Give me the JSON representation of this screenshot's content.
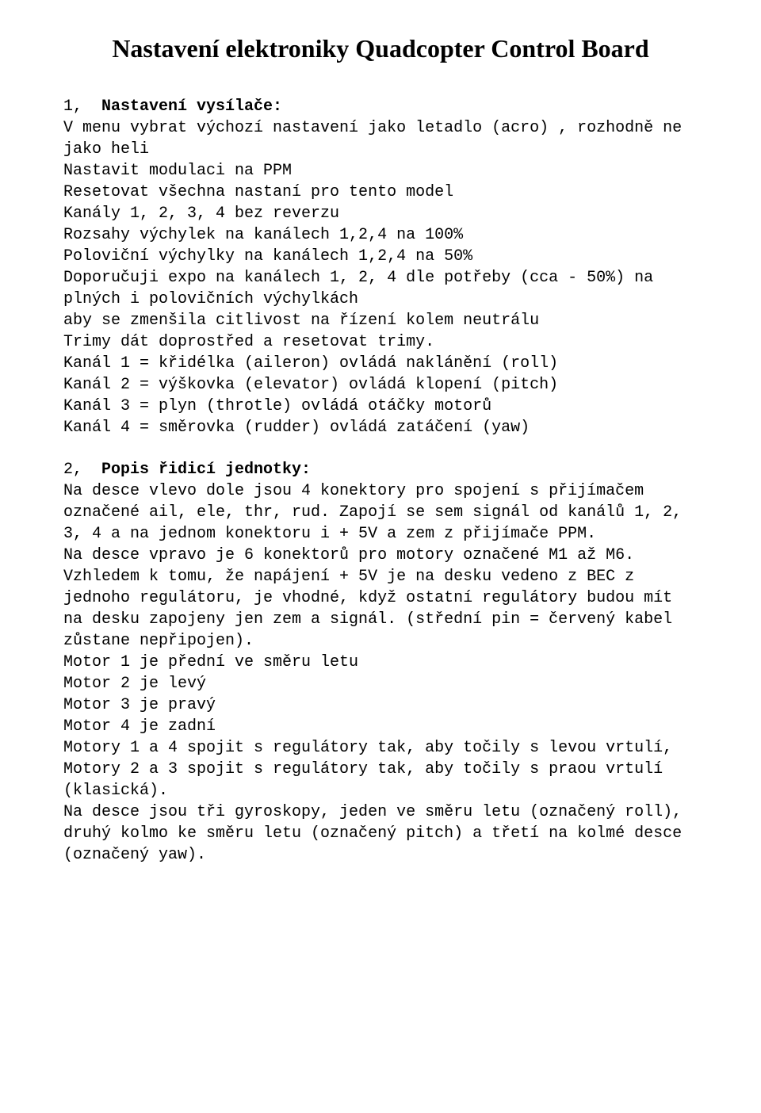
{
  "title": "Nastavení elektroniky Quadcopter Control Board",
  "section1": {
    "num": "1,  ",
    "heading": "Nastavení vysílače:",
    "body": "V menu vybrat výchozí nastavení jako letadlo (acro) , rozhodně ne jako heli\nNastavit modulaci na PPM\nResetovat všechna nastaní pro tento model\nKanály 1, 2, 3, 4 bez reverzu\nRozsahy výchylek na kanálech 1,2,4 na 100%\nPoloviční výchylky na kanálech 1,2,4 na 50%\nDoporučuji expo na kanálech 1, 2, 4 dle potřeby (cca - 50%) na plných i polovičních výchylkách\naby se zmenšila citlivost na řízení kolem neutrálu\nTrimy dát doprostřed a resetovat trimy.\nKanál 1 = křidélka (aileron) ovládá naklánění (roll)\nKanál 2 = výškovka (elevator) ovládá klopení (pitch)\nKanál 3 = plyn (throtle) ovládá otáčky motorů\nKanál 4 = směrovka (rudder) ovládá zatáčení (yaw)"
  },
  "section2": {
    "num": "2,  ",
    "heading": "Popis řidicí jednotky:",
    "body": "Na desce vlevo dole jsou 4 konektory pro spojení s přijímačem označené ail, ele, thr, rud. Zapojí se sem signál od kanálů 1, 2, 3, 4 a na jednom konektoru i + 5V a zem z přijímače PPM.\nNa desce vpravo je 6 konektorů pro motory označené M1 až M6. Vzhledem k tomu, že napájení + 5V je na desku vedeno z BEC z jednoho regulátoru, je vhodné, když ostatní regulátory budou mít na desku zapojeny jen zem a signál. (střední pin = červený kabel zůstane nepřipojen).\nMotor 1 je přední ve směru letu\nMotor 2 je levý\nMotor 3 je pravý\nMotor 4 je zadní\nMotory 1 a 4 spojit s regulátory tak, aby točily s levou vrtulí,\nMotory 2 a 3 spojit s regulátory tak, aby točily s praou vrtulí (klasická).\nNa desce jsou tři gyroskopy, jeden ve směru letu (označený roll), druhý kolmo ke směru letu (označený pitch) a třetí na kolmé desce (označený yaw)."
  }
}
